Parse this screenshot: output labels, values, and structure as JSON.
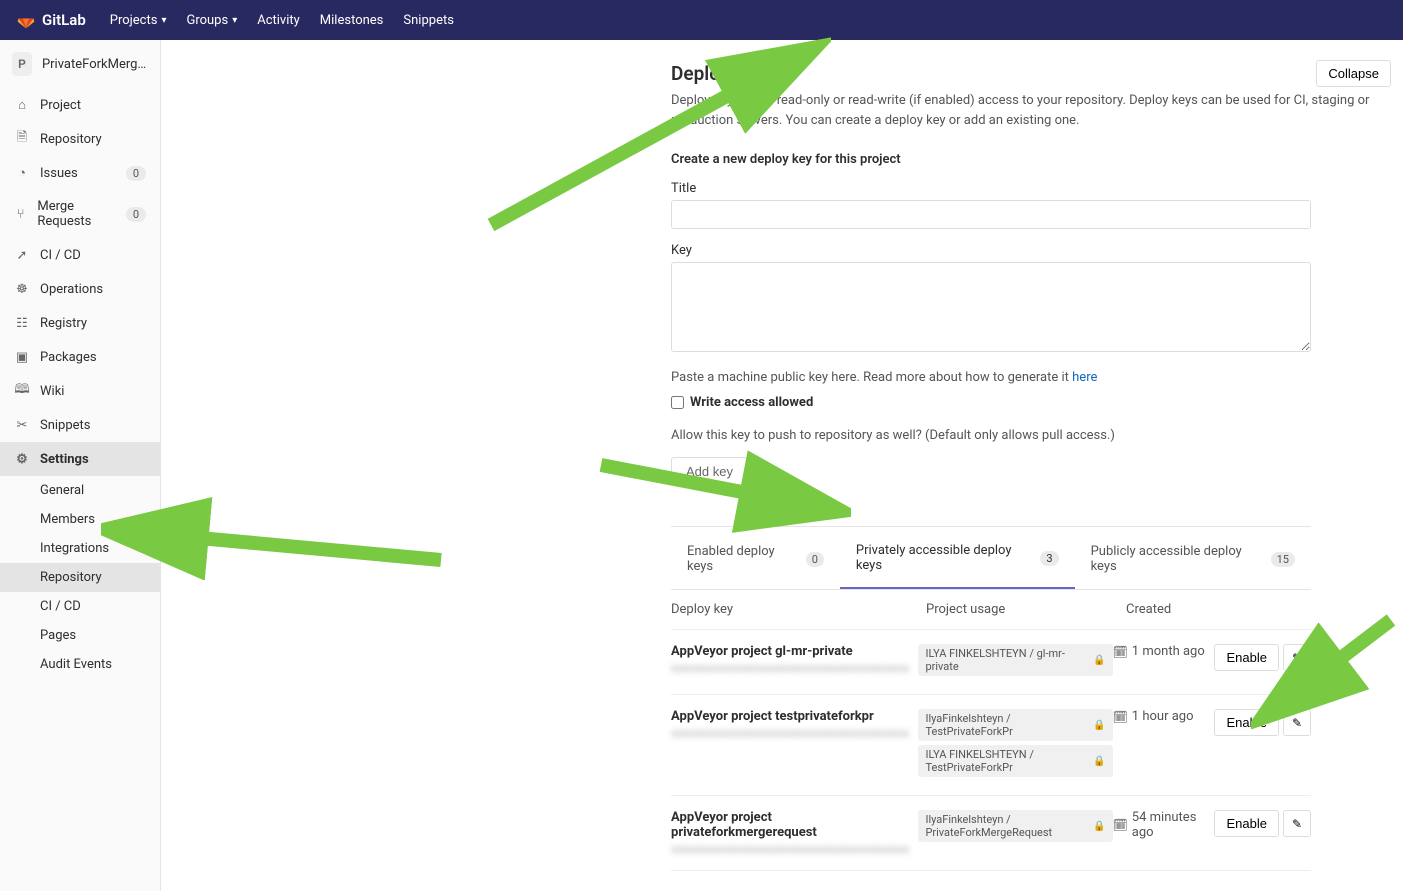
{
  "navbar": {
    "brand": "GitLab",
    "projects": "Projects",
    "groups": "Groups",
    "activity": "Activity",
    "milestones": "Milestones",
    "snippets": "Snippets"
  },
  "project": {
    "avatar_letter": "P",
    "name": "PrivateForkMergeRe..."
  },
  "sidebar": {
    "project": "Project",
    "repository": "Repository",
    "issues": "Issues",
    "issues_count": "0",
    "merge_requests": "Merge Requests",
    "mr_count": "0",
    "cicd": "CI / CD",
    "operations": "Operations",
    "registry": "Registry",
    "packages": "Packages",
    "wiki": "Wiki",
    "snippets": "Snippets",
    "settings": "Settings",
    "sub": {
      "general": "General",
      "members": "Members",
      "integrations": "Integrations",
      "repository": "Repository",
      "cicd": "CI / CD",
      "pages": "Pages",
      "audit_events": "Audit Events"
    }
  },
  "section": {
    "title": "Deploy Keys",
    "collapse": "Collapse",
    "desc": "Deploy keys allow read-only or read-write (if enabled) access to your repository. Deploy keys can be used for CI, staging or production servers. You can create a deploy key or add an existing one."
  },
  "form": {
    "heading": "Create a new deploy key for this project",
    "title_label": "Title",
    "key_label": "Key",
    "help_text": "Paste a machine public key here. Read more about how to generate it ",
    "help_link": "here",
    "write_access": "Write access allowed",
    "allow_push": "Allow this key to push to repository as well? (Default only allows pull access.)",
    "add_key": "Add key"
  },
  "tabs": {
    "enabled": "Enabled deploy keys",
    "enabled_count": "0",
    "private": "Privately accessible deploy keys",
    "private_count": "3",
    "public": "Publicly accessible deploy keys",
    "public_count": "15"
  },
  "table": {
    "col_key": "Deploy key",
    "col_usage": "Project usage",
    "col_created": "Created",
    "enable": "Enable",
    "rows": [
      {
        "name": "AppVeyor project gl-mr-private",
        "fingerprint": "xxxxxxxxxxxxxxxxxxxxxxxxxxxxxxxxxxxxxxxx",
        "usages": [
          "ILYA FINKELSHTEYN / gl-mr-private"
        ],
        "created": "1 month ago"
      },
      {
        "name": "AppVeyor project testprivateforkpr",
        "fingerprint": "xxxxxxxxxxxxxxxxxxxxxxxxxxxxxxxxxxxxxxxx",
        "usages": [
          "IlyaFinkelshteyn / TestPrivateForkPr",
          "ILYA FINKELSHTEYN / TestPrivateForkPr"
        ],
        "created": "1 hour ago"
      },
      {
        "name": "AppVeyor project privateforkmergerequest",
        "fingerprint": "xxxxxxxxxxxxxxxxxxxxxxxxxxxxxxxxxxxxxxxx",
        "usages": [
          "IlyaFinkelshteyn / PrivateForkMergeRequest"
        ],
        "created": "54 minutes ago"
      }
    ]
  }
}
